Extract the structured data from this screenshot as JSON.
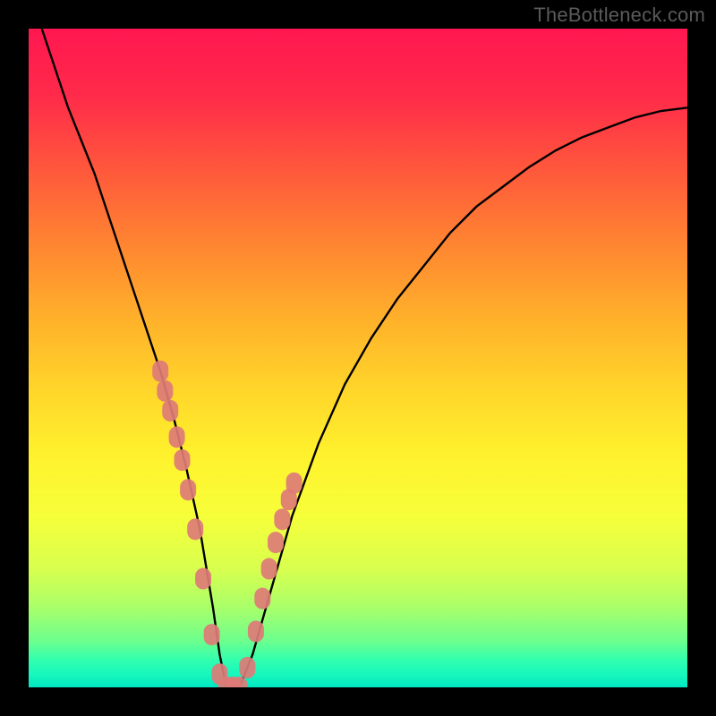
{
  "watermark": "TheBottleneck.com",
  "colors": {
    "background": "#000000",
    "gradient_top": "#ff1750",
    "gradient_bottom": "#00e8c3",
    "curve": "#000000",
    "marker": "#dd7b77"
  },
  "chart_data": {
    "type": "line",
    "title": "",
    "xlabel": "",
    "ylabel": "",
    "xlim": [
      0,
      100
    ],
    "ylim": [
      0,
      100
    ],
    "series": [
      {
        "name": "bottleneck-curve",
        "x": [
          2,
          4,
          6,
          8,
          10,
          12,
          14,
          16,
          18,
          20,
          22,
          24,
          26,
          28,
          29,
          30,
          31,
          32,
          34,
          36,
          38,
          40,
          44,
          48,
          52,
          56,
          60,
          64,
          68,
          72,
          76,
          80,
          84,
          88,
          92,
          96,
          100
        ],
        "y": [
          100,
          94,
          88,
          83,
          78,
          72,
          66,
          60,
          54,
          48,
          41,
          33,
          24,
          12,
          5,
          0,
          0,
          0,
          5,
          12,
          19,
          26,
          37,
          46,
          53,
          59,
          64,
          69,
          73,
          76,
          79,
          81.5,
          83.5,
          85,
          86.5,
          87.5,
          88
        ]
      }
    ],
    "markers": {
      "name": "highlight-dots",
      "x": [
        20.0,
        20.7,
        21.5,
        22.5,
        23.3,
        24.2,
        25.3,
        26.5,
        27.8,
        29.0,
        30.0,
        31.0,
        32.0,
        33.2,
        34.5,
        35.5,
        36.5,
        37.5,
        38.5,
        39.5,
        40.3
      ],
      "y": [
        48.0,
        45.0,
        42.0,
        38.0,
        34.5,
        30.0,
        24.0,
        16.5,
        8.0,
        2.0,
        0.0,
        0.0,
        0.0,
        3.0,
        8.5,
        13.5,
        18.0,
        22.0,
        25.5,
        28.5,
        31.0
      ]
    }
  }
}
